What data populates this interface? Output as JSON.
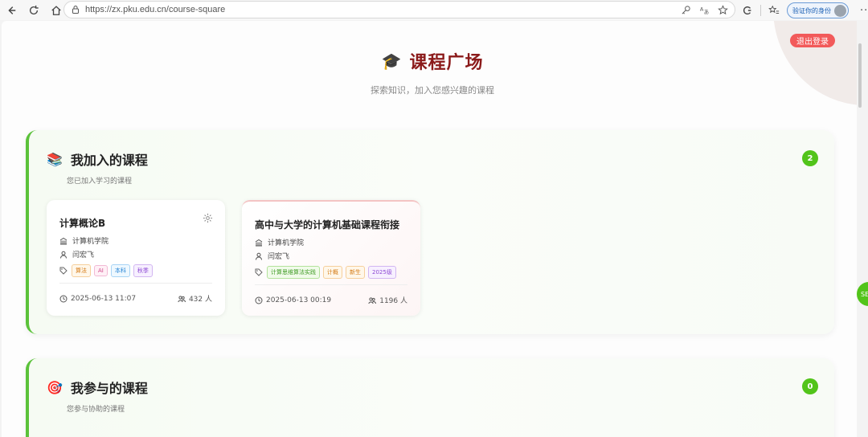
{
  "browser": {
    "url": "https://zx.pku.edu.cn/course-square",
    "profile_label": "验证你的身份"
  },
  "header": {
    "logout": "退出登录",
    "title": "课程广场",
    "subtitle": "探索知识，加入您感兴趣的课程"
  },
  "joined": {
    "title": "我加入的课程",
    "subtitle": "您已加入学习的课程",
    "count": "2",
    "courses": [
      {
        "title": "计算概论B",
        "department": "计算机学院",
        "teacher": "闫宏飞",
        "tags": [
          "算法",
          "AI",
          "本科",
          "秋季"
        ],
        "date": "2025-06-13 11:07",
        "members": "432 人"
      },
      {
        "title": "高中与大学的计算机基础课程衔接",
        "department": "计算机学院",
        "teacher": "闫宏飞",
        "tags": [
          "计算思维算法实践",
          "计概",
          "新生",
          "2025级"
        ],
        "date": "2025-06-13 00:19",
        "members": "1196 人"
      }
    ]
  },
  "participated": {
    "title": "我参与的课程",
    "subtitle": "您参与协助的课程",
    "count": "0"
  },
  "side_bubble": "SE",
  "colors": {
    "accent_green": "#52c41a",
    "title_red": "#8b1a1a",
    "logout_red": "#f25a5a"
  }
}
